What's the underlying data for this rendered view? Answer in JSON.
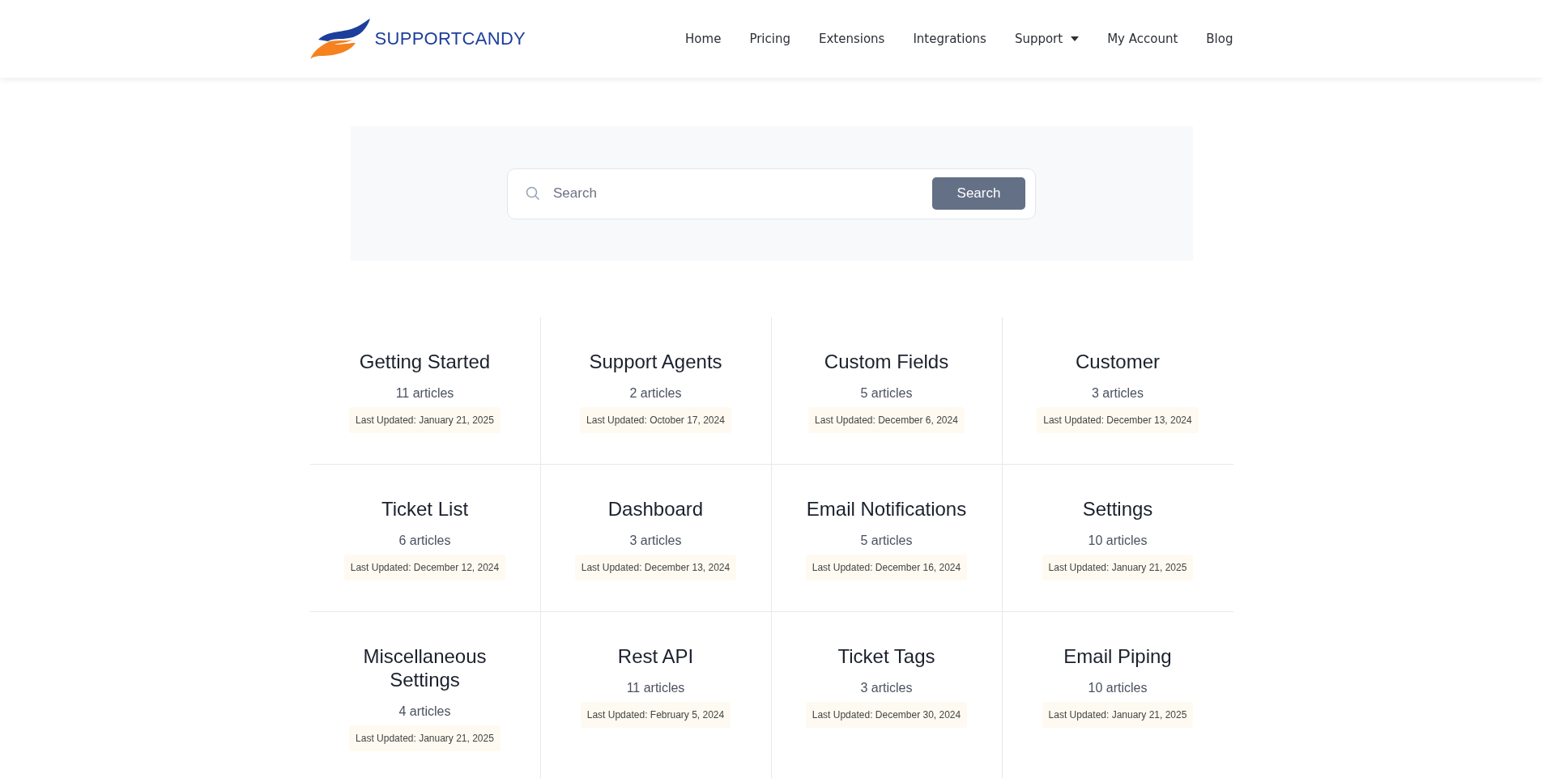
{
  "header": {
    "brand": "SUPPORTCANDY",
    "nav": [
      {
        "label": "Home",
        "has_menu": false
      },
      {
        "label": "Pricing",
        "has_menu": false
      },
      {
        "label": "Extensions",
        "has_menu": false
      },
      {
        "label": "Integrations",
        "has_menu": false
      },
      {
        "label": "Support",
        "has_menu": true
      },
      {
        "label": "My Account",
        "has_menu": false
      },
      {
        "label": "Blog",
        "has_menu": false
      }
    ]
  },
  "search": {
    "placeholder": "Search",
    "button": "Search"
  },
  "categories": [
    {
      "title": "Getting Started",
      "count": "11 articles",
      "updated": "Last Updated: January 21, 2025"
    },
    {
      "title": "Support Agents",
      "count": "2 articles",
      "updated": "Last Updated: October 17, 2024"
    },
    {
      "title": "Custom Fields",
      "count": "5 articles",
      "updated": "Last Updated: December 6, 2024"
    },
    {
      "title": "Customer",
      "count": "3 articles",
      "updated": "Last Updated: December 13, 2024"
    },
    {
      "title": "Ticket List",
      "count": "6 articles",
      "updated": "Last Updated: December 12, 2024"
    },
    {
      "title": "Dashboard",
      "count": "3 articles",
      "updated": "Last Updated: December 13, 2024"
    },
    {
      "title": "Email Notifications",
      "count": "5 articles",
      "updated": "Last Updated: December 16, 2024"
    },
    {
      "title": "Settings",
      "count": "10 articles",
      "updated": "Last Updated: January 21, 2025"
    },
    {
      "title": "Miscellaneous Settings",
      "count": "4 articles",
      "updated": "Last Updated: January 21, 2025"
    },
    {
      "title": "Rest API",
      "count": "11 articles",
      "updated": "Last Updated: February 5, 2024"
    },
    {
      "title": "Ticket Tags",
      "count": "3 articles",
      "updated": "Last Updated: December 30, 2024"
    },
    {
      "title": "Email Piping",
      "count": "10 articles",
      "updated": "Last Updated: January 21, 2025"
    }
  ]
}
